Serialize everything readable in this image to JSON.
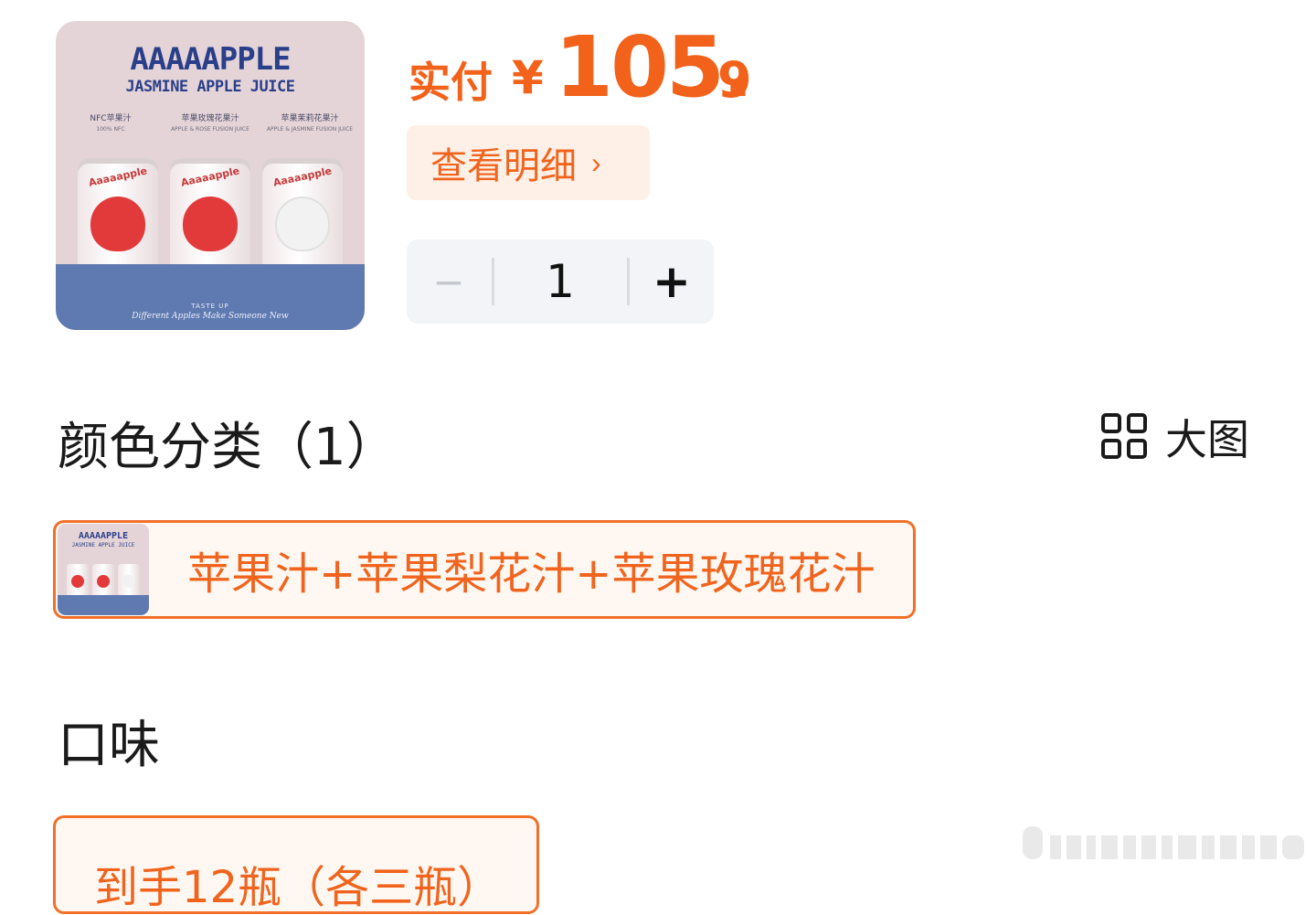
{
  "product": {
    "image": {
      "brand_title": "AAAAAPPLE",
      "brand_sub": "JASMINE APPLE JUICE",
      "variants": [
        {
          "name": "NFC苹果汁",
          "sub": "100% NFC"
        },
        {
          "name": "苹果玫瑰花果汁",
          "sub": "APPLE & ROSE FUSION JUICE"
        },
        {
          "name": "苹果茉莉花果汁",
          "sub": "APPLE & JASMINE FUSION JUICE"
        }
      ],
      "can_brand": "Aaaaapple",
      "tag_small": "TASTE UP",
      "tagline": "Different Apples Make Someone New",
      "colors": {
        "bg": "#e5d4d7",
        "bottom": "#5f7ab0",
        "apple_red": "#e23a3a",
        "apple_light": "#f0f0f0"
      }
    }
  },
  "price": {
    "label": "实付",
    "currency": "¥",
    "integer": "105.",
    "decimal": "9",
    "color": "#f2621a"
  },
  "detail_button": {
    "label": "查看明细",
    "chevron": "›"
  },
  "quantity": {
    "minus": "−",
    "value": "1",
    "plus": "+"
  },
  "color_category": {
    "title": "颜色分类（1）",
    "view_toggle_label": "大图",
    "view_toggle_icon": "grid-icon",
    "options": [
      {
        "label": "苹果汁+苹果梨花汁+苹果玫瑰花汁",
        "selected": true
      }
    ]
  },
  "flavor": {
    "title": "口味",
    "options": [
      {
        "label": "到手12瓶（各三瓶）",
        "selected": true
      }
    ]
  },
  "accent_color": "#f2702a"
}
